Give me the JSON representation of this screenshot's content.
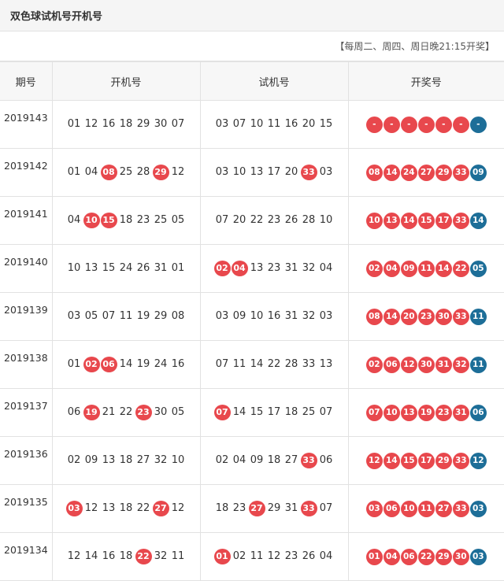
{
  "title": "双色球试机号开机号",
  "note": "【每周二、周四、周日晚21:15开奖】",
  "headers": [
    "期号",
    "开机号",
    "试机号",
    "开奖号"
  ],
  "colors": {
    "red": "#e8484d",
    "blue": "#1d6e98"
  },
  "rows": [
    {
      "issue": "2019143",
      "open": [
        "01",
        "12",
        "16",
        "18",
        "29",
        "30",
        "07"
      ],
      "open_hits": [],
      "trial": [
        "03",
        "07",
        "10",
        "11",
        "16",
        "20",
        "15"
      ],
      "trial_hits": [],
      "draw": [
        "-",
        "-",
        "-",
        "-",
        "-",
        "-",
        "-"
      ]
    },
    {
      "issue": "2019142",
      "open": [
        "01",
        "04",
        "08",
        "25",
        "28",
        "29",
        "12"
      ],
      "open_hits": [
        2,
        5
      ],
      "trial": [
        "03",
        "10",
        "13",
        "17",
        "20",
        "33",
        "03"
      ],
      "trial_hits": [
        5
      ],
      "draw": [
        "08",
        "14",
        "24",
        "27",
        "29",
        "33",
        "09"
      ]
    },
    {
      "issue": "2019141",
      "open": [
        "04",
        "10",
        "15",
        "18",
        "23",
        "25",
        "05"
      ],
      "open_hits": [
        1,
        2
      ],
      "trial": [
        "07",
        "20",
        "22",
        "23",
        "26",
        "28",
        "10"
      ],
      "trial_hits": [],
      "draw": [
        "10",
        "13",
        "14",
        "15",
        "17",
        "33",
        "14"
      ]
    },
    {
      "issue": "2019140",
      "open": [
        "10",
        "13",
        "15",
        "24",
        "26",
        "31",
        "01"
      ],
      "open_hits": [],
      "trial": [
        "02",
        "04",
        "13",
        "23",
        "31",
        "32",
        "04"
      ],
      "trial_hits": [
        0,
        1
      ],
      "draw": [
        "02",
        "04",
        "09",
        "11",
        "14",
        "22",
        "05"
      ]
    },
    {
      "issue": "2019139",
      "open": [
        "03",
        "05",
        "07",
        "11",
        "19",
        "29",
        "08"
      ],
      "open_hits": [],
      "trial": [
        "03",
        "09",
        "10",
        "16",
        "31",
        "32",
        "03"
      ],
      "trial_hits": [],
      "draw": [
        "08",
        "14",
        "20",
        "23",
        "30",
        "33",
        "11"
      ]
    },
    {
      "issue": "2019138",
      "open": [
        "01",
        "02",
        "06",
        "14",
        "19",
        "24",
        "16"
      ],
      "open_hits": [
        1,
        2
      ],
      "trial": [
        "07",
        "11",
        "14",
        "22",
        "28",
        "33",
        "13"
      ],
      "trial_hits": [],
      "draw": [
        "02",
        "06",
        "12",
        "30",
        "31",
        "32",
        "11"
      ]
    },
    {
      "issue": "2019137",
      "open": [
        "06",
        "19",
        "21",
        "22",
        "23",
        "30",
        "05"
      ],
      "open_hits": [
        1,
        4
      ],
      "trial": [
        "07",
        "14",
        "15",
        "17",
        "18",
        "25",
        "07"
      ],
      "trial_hits": [
        0
      ],
      "draw": [
        "07",
        "10",
        "13",
        "19",
        "23",
        "31",
        "06"
      ]
    },
    {
      "issue": "2019136",
      "open": [
        "02",
        "09",
        "13",
        "18",
        "27",
        "32",
        "10"
      ],
      "open_hits": [],
      "trial": [
        "02",
        "04",
        "09",
        "18",
        "27",
        "33",
        "06"
      ],
      "trial_hits": [
        5
      ],
      "draw": [
        "12",
        "14",
        "15",
        "17",
        "29",
        "33",
        "12"
      ]
    },
    {
      "issue": "2019135",
      "open": [
        "03",
        "12",
        "13",
        "18",
        "22",
        "27",
        "12"
      ],
      "open_hits": [
        0,
        5
      ],
      "trial": [
        "18",
        "23",
        "27",
        "29",
        "31",
        "33",
        "07"
      ],
      "trial_hits": [
        2,
        5
      ],
      "draw": [
        "03",
        "06",
        "10",
        "11",
        "27",
        "33",
        "03"
      ]
    },
    {
      "issue": "2019134",
      "open": [
        "12",
        "14",
        "16",
        "18",
        "22",
        "32",
        "11"
      ],
      "open_hits": [
        4
      ],
      "trial": [
        "01",
        "02",
        "11",
        "12",
        "23",
        "26",
        "04"
      ],
      "trial_hits": [
        0
      ],
      "draw": [
        "01",
        "04",
        "06",
        "22",
        "29",
        "30",
        "03"
      ]
    }
  ]
}
